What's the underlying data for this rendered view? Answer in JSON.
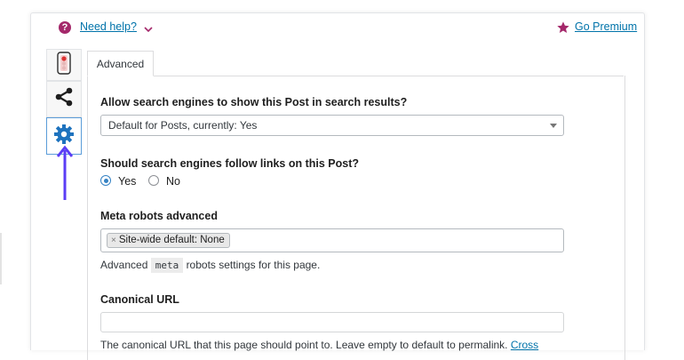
{
  "header": {
    "help_label": "Need help?",
    "premium_label": "Go Premium"
  },
  "tabs": {
    "advanced_label": "Advanced"
  },
  "side_tabs": [
    {
      "icon": "traffic-light-icon"
    },
    {
      "icon": "share-icon"
    },
    {
      "icon": "gear-icon",
      "active": true
    }
  ],
  "form": {
    "search_visibility": {
      "label": "Allow search engines to show this Post in search results?",
      "value": "Default for Posts, currently: Yes"
    },
    "follow_links": {
      "label": "Should search engines follow links on this Post?",
      "options": [
        "Yes",
        "No"
      ],
      "selected": "Yes"
    },
    "meta_robots": {
      "label": "Meta robots advanced",
      "chip": "Site-wide default: None",
      "chip_remove": "×",
      "desc_before": "Advanced",
      "desc_code": "meta",
      "desc_after": "robots settings for this page."
    },
    "canonical": {
      "label": "Canonical URL",
      "value": "",
      "desc": "The canonical URL that this page should point to. Leave empty to default to permalink.",
      "desc_link": "Cross"
    }
  },
  "colors": {
    "accent": "#a4286a",
    "link": "#0073aa",
    "arrow": "#5b3df5",
    "gear": "#1e73be"
  }
}
